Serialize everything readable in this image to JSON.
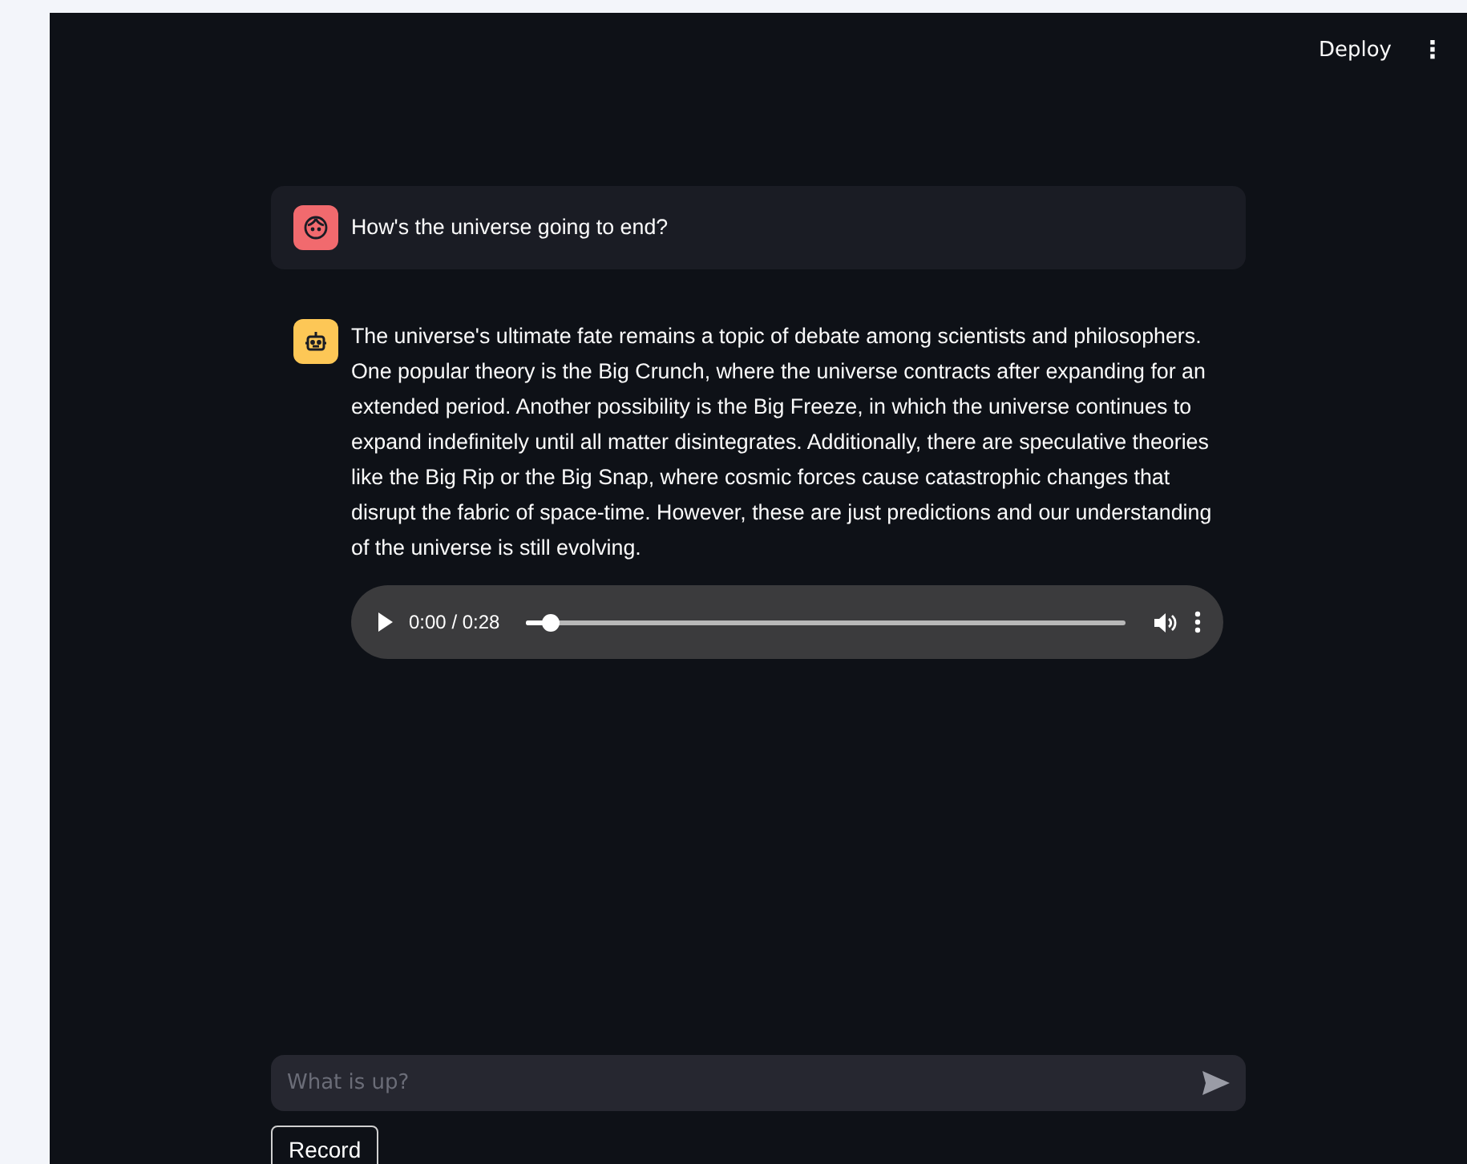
{
  "header": {
    "deploy": "Deploy",
    "menu": "⋮"
  },
  "messages": [
    {
      "kind": "user",
      "text": "How's the universe going to end?"
    },
    {
      "kind": "assistant",
      "text": "The universe's ultimate fate remains a topic of debate among scientists and philosophers. One popular theory is the Big Crunch, where the universe contracts after expanding for an extended period. Another possibility is the Big Freeze, in which the universe continues to expand indefinitely until all matter disintegrates. Additionally, there are speculative theories like the Big Rip or the Big Snap, where cosmic forces cause catastrophic changes that disrupt the fabric of space-time. However, these are just predictions and our understanding of the universe is still evolving.",
      "audio": {
        "time": "0:00 / 0:28",
        "level": 0.04
      }
    }
  ],
  "chat_input": {
    "placeholder": "What is up?"
  },
  "record_button": "Record"
}
